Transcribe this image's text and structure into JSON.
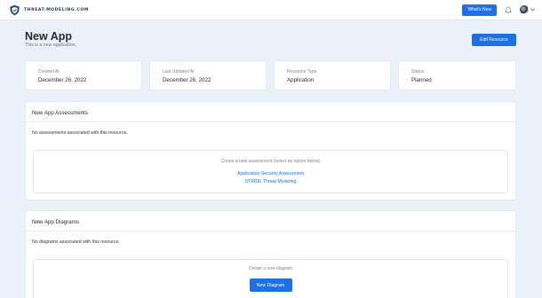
{
  "header": {
    "logo_text": "THREAT-MODELING.COM",
    "whats_new_label": "What's New"
  },
  "page": {
    "title": "New App",
    "subtitle": "This is a new application.",
    "edit_label": "Edit Resource"
  },
  "stats": [
    {
      "label": "Created At",
      "value": "December 26, 2022"
    },
    {
      "label": "Last Updated At",
      "value": "December 26, 2022"
    },
    {
      "label": "Resource Type",
      "value": "Application"
    },
    {
      "label": "Status",
      "value": "Planned"
    }
  ],
  "assessments": {
    "title": "New App Assessments",
    "empty_text": "No assessments associated with this resource.",
    "prompt": "Create a new assessment (select an option below)",
    "options": [
      "Application Security Assessment",
      "STRIDE Threat Modeling"
    ]
  },
  "diagrams": {
    "title": "New App Diagrams",
    "empty_text": "No diagrams associated with this resource.",
    "prompt": "Create a new diagram",
    "button_label": "New Diagram"
  },
  "colors": {
    "accent": "#1f6fe5",
    "background": "#eaf1fb",
    "card": "#ffffff"
  }
}
